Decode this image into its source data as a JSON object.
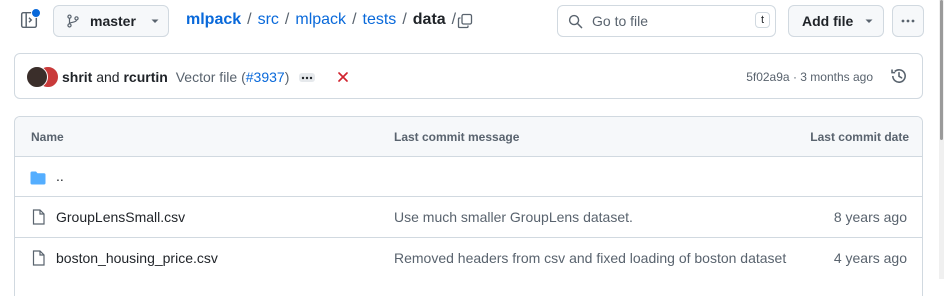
{
  "header": {
    "branch": "master",
    "breadcrumb": [
      "mlpack",
      "src",
      "mlpack",
      "tests"
    ],
    "current": "data",
    "trailing_sep": "/",
    "search_placeholder": "Go to file",
    "search_key": "t",
    "add_file_label": "Add file"
  },
  "commit": {
    "authors_a": "shrit",
    "and": "and",
    "authors_b": "rcurtin",
    "message": "Vector file (",
    "pr": "#3937",
    "message_end": ")",
    "status_icon": "x-icon",
    "hash": "5f02a9a",
    "dot": "·",
    "age": "3 months ago"
  },
  "table": {
    "headers": {
      "name": "Name",
      "message": "Last commit message",
      "date": "Last commit date"
    },
    "parent": "..",
    "rows": [
      {
        "name": "GroupLensSmall.csv",
        "message": "Use much smaller GroupLens dataset.",
        "date": "8 years ago"
      },
      {
        "name": "boston_housing_price.csv",
        "message": "Removed headers from csv and fixed loading of boston dataset",
        "date": "4 years ago"
      }
    ]
  },
  "colors": {
    "accent": "#0969da",
    "border": "#d1d9e0",
    "muted": "#59636e",
    "fail": "#d1242f",
    "folder": "#54aeff"
  }
}
